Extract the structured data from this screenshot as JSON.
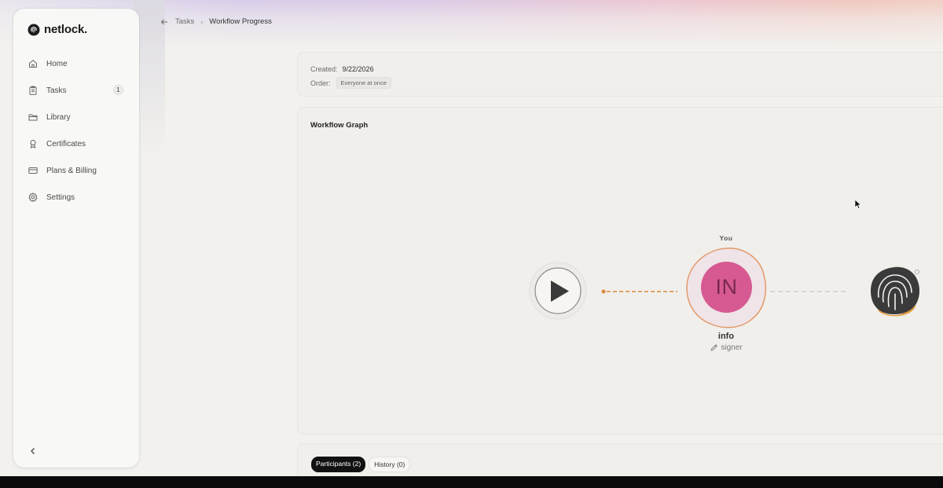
{
  "app": {
    "brand": "netlock."
  },
  "sidebar": {
    "items": [
      {
        "label": "Home",
        "icon": "home-icon"
      },
      {
        "label": "Tasks",
        "icon": "clipboard-icon",
        "badge": "1"
      },
      {
        "label": "Library",
        "icon": "folder-icon"
      },
      {
        "label": "Certificates",
        "icon": "award-icon"
      },
      {
        "label": "Plans & Billing",
        "icon": "credit-card-icon"
      },
      {
        "label": "Settings",
        "icon": "gear-icon"
      }
    ]
  },
  "breadcrumb": {
    "parent": "Tasks",
    "current": "Workflow Progress"
  },
  "meta": {
    "created_label": "Created:",
    "created_value": "9/22/2026",
    "order_label": "Order:",
    "order_value": "Everyone at once"
  },
  "graph": {
    "title": "Workflow Graph",
    "signer": {
      "you_label": "You",
      "initials": "IN",
      "name": "info",
      "role": "signer"
    },
    "colors": {
      "accent_orange": "#d98a3a",
      "avatar_pink": "#d65a91",
      "finish_dark": "#3a3a3a"
    }
  },
  "tabs": [
    {
      "label": "Participants (2)",
      "active": true
    },
    {
      "label": "History (0)",
      "active": false
    }
  ]
}
